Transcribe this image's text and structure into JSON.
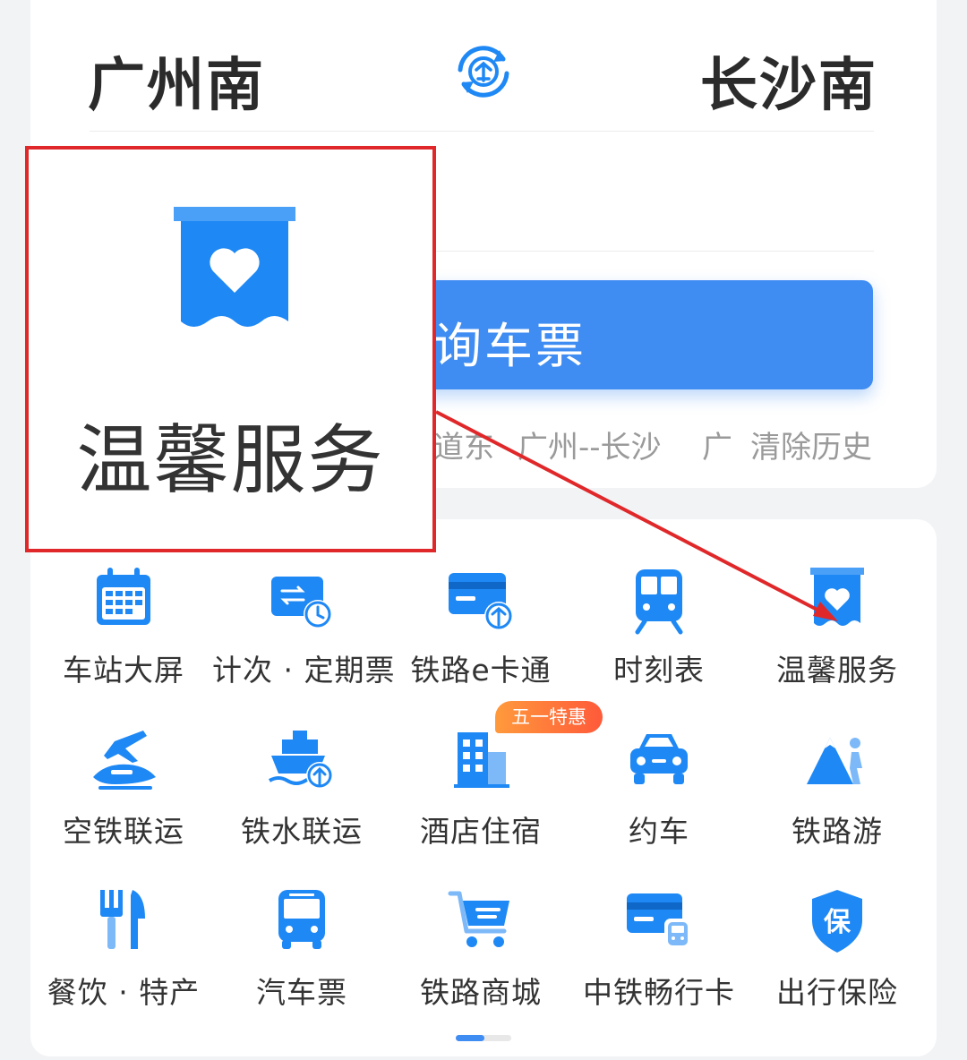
{
  "route": {
    "from_station": "广州南",
    "to_station": "长沙南",
    "query_button": "询车票",
    "history": [
      "道东",
      "广州--长沙",
      "广"
    ],
    "clear_history": "清除历史"
  },
  "grid": {
    "items": [
      {
        "label": "车站大屏",
        "icon": "calendar-screen-icon"
      },
      {
        "label": "计次 · 定期票",
        "icon": "ticket-clock-icon"
      },
      {
        "label": "铁路e卡通",
        "icon": "rail-card-icon"
      },
      {
        "label": "时刻表",
        "icon": "train-front-icon"
      },
      {
        "label": "温馨服务",
        "icon": "heart-service-icon"
      },
      {
        "label": "空铁联运",
        "icon": "plane-train-icon"
      },
      {
        "label": "铁水联运",
        "icon": "ship-rail-icon"
      },
      {
        "label": "酒店住宿",
        "icon": "hotel-building-icon"
      },
      {
        "label": "约车",
        "icon": "car-icon"
      },
      {
        "label": "铁路游",
        "icon": "mountain-hiker-icon"
      },
      {
        "label": "餐饮 · 特产",
        "icon": "fork-knife-icon"
      },
      {
        "label": "汽车票",
        "icon": "bus-icon"
      },
      {
        "label": "铁路商城",
        "icon": "shopping-cart-icon"
      },
      {
        "label": "中铁畅行卡",
        "icon": "card-train-icon"
      },
      {
        "label": "出行保险",
        "icon": "insurance-shield-icon"
      }
    ],
    "promo_badge": "五一特惠"
  },
  "callout": {
    "label": "温馨服务",
    "icon": "heart-service-icon"
  },
  "colors": {
    "accent": "#3f8cf2",
    "icon_blue": "#1e88f5",
    "callout_border": "#e0282a",
    "promo": "#ff6a3a"
  }
}
